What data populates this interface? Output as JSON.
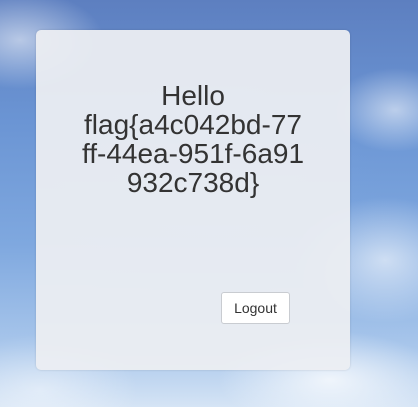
{
  "card": {
    "greeting": "Hello",
    "flag": "flag{a4c042bd-77ff-44ea-951f-6a91932c738d}"
  },
  "actions": {
    "logout_label": "Logout"
  }
}
